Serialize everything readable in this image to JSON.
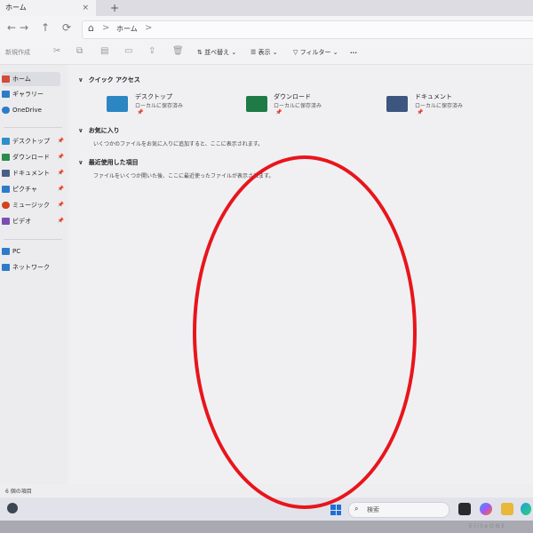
{
  "tab": {
    "title": "ホーム",
    "close": "×",
    "new": "+"
  },
  "nav": {
    "back": "←",
    "forward": "→",
    "up": "↑",
    "refresh": "⟳"
  },
  "address": {
    "crumb": "ホーム",
    "sep": ">"
  },
  "toolbar": {
    "new_label": "新規作成",
    "sort_label": "並べ替え",
    "view_label": "表示",
    "filter_label": "フィルター",
    "more_label": "..."
  },
  "sidebar": {
    "top": [
      {
        "label": "ホーム",
        "color": "#d14b3b"
      },
      {
        "label": "ギャラリー",
        "color": "#2e7cc9"
      },
      {
        "label": "OneDrive",
        "color": "#2e7cc9"
      }
    ],
    "pinned": [
      {
        "label": "デスクトップ",
        "color": "#2d8fc7",
        "pin": "📌"
      },
      {
        "label": "ダウンロード",
        "color": "#2a8c4a",
        "pin": "📌"
      },
      {
        "label": "ドキュメント",
        "color": "#4a5f85",
        "pin": "📌"
      },
      {
        "label": "ピクチャ",
        "color": "#2e7cc9",
        "pin": "📌"
      },
      {
        "label": "ミュージック",
        "color": "#d4431f",
        "pin": "📌"
      },
      {
        "label": "ビデオ",
        "color": "#7a4fb5",
        "pin": "📌"
      }
    ],
    "bottom": [
      {
        "label": "PC",
        "color": "#2e7cc9"
      },
      {
        "label": "ネットワーク",
        "color": "#2e7cc9"
      }
    ]
  },
  "main": {
    "quick_access": {
      "title": "クイック アクセス",
      "folders": [
        {
          "name": "デスクトップ",
          "sub": "ローカルに保存済み",
          "color": "#2b86c2"
        },
        {
          "name": "ダウンロード",
          "sub": "ローカルに保存済み",
          "color": "#1f7a45"
        },
        {
          "name": "ドキュメント",
          "sub": "ローカルに保存済み",
          "color": "#3d5680"
        }
      ]
    },
    "favorites": {
      "title": "お気に入り",
      "text": "いくつかのファイルをお気に入りに追加すると、ここに表示されます。"
    },
    "recent": {
      "title": "最近使用した項目",
      "text": "ファイルをいくつか開いた後、ここに最近使ったファイルが表示されます。"
    }
  },
  "status": {
    "items": "6 個の項目"
  },
  "taskbar": {
    "search_placeholder": "検索"
  },
  "bezel": {
    "brand": "EliteONE"
  },
  "annotation": {
    "color": "#e8151b"
  }
}
